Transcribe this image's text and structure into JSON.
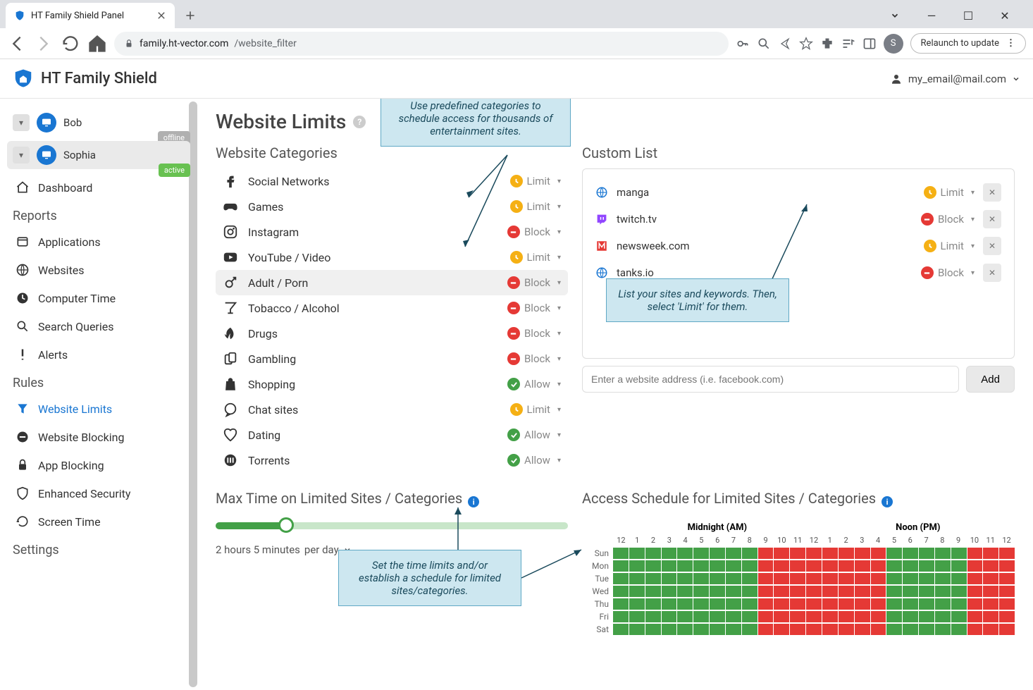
{
  "browser": {
    "tab_title": "HT Family Shield Panel",
    "url_host": "family.ht-vector.com",
    "url_path": "/website_filter",
    "avatar_letter": "S",
    "relaunch_label": "Relaunch to update"
  },
  "app": {
    "title": "HT Family Shield",
    "user_email": "my_email@mail.com"
  },
  "sidebar": {
    "users": [
      {
        "name": "Bob",
        "status": "offline"
      },
      {
        "name": "Sophia",
        "status": "active"
      }
    ],
    "dashboard": "Dashboard",
    "section_reports": "Reports",
    "reports": [
      "Applications",
      "Websites",
      "Computer Time",
      "Search Queries",
      "Alerts"
    ],
    "section_rules": "Rules",
    "rules": [
      "Website Limits",
      "Website Blocking",
      "App Blocking",
      "Enhanced Security",
      "Screen Time"
    ],
    "section_settings": "Settings"
  },
  "page": {
    "title": "Website Limits",
    "categories_heading": "Website Categories",
    "categories": [
      {
        "name": "Social Networks",
        "status": "Limit",
        "icon": "facebook"
      },
      {
        "name": "Games",
        "status": "Limit",
        "icon": "gamepad"
      },
      {
        "name": "Instagram",
        "status": "Block",
        "icon": "instagram"
      },
      {
        "name": "YouTube / Video",
        "status": "Limit",
        "icon": "youtube"
      },
      {
        "name": "Adult / Porn",
        "status": "Block",
        "icon": "adult",
        "highlight": true
      },
      {
        "name": "Tobacco / Alcohol",
        "status": "Block",
        "icon": "cocktail"
      },
      {
        "name": "Drugs",
        "status": "Block",
        "icon": "leaf"
      },
      {
        "name": "Gambling",
        "status": "Block",
        "icon": "cards"
      },
      {
        "name": "Shopping",
        "status": "Allow",
        "icon": "bag"
      },
      {
        "name": "Chat sites",
        "status": "Limit",
        "icon": "chat"
      },
      {
        "name": "Dating",
        "status": "Allow",
        "icon": "heart"
      },
      {
        "name": "Torrents",
        "status": "Allow",
        "icon": "torrent"
      }
    ],
    "custom_heading": "Custom List",
    "custom": [
      {
        "name": "manga",
        "status": "Limit",
        "icon": "globe"
      },
      {
        "name": "twitch.tv",
        "status": "Block",
        "icon": "twitch"
      },
      {
        "name": "newsweek.com",
        "status": "Limit",
        "icon": "newsweek"
      },
      {
        "name": "tanks.io",
        "status": "Block",
        "icon": "globe"
      }
    ],
    "add_placeholder": "Enter a website address (i.e. facebook.com)",
    "add_label": "Add",
    "maxtime_heading": "Max Time on Limited Sites / Categories",
    "maxtime_value": "2 hours 5 minutes",
    "maxtime_unit": "per day",
    "schedule_heading": "Access Schedule for Limited Sites / Categories",
    "schedule_am": "Midnight (AM)",
    "schedule_pm": "Noon (PM)",
    "schedule_ticks": [
      "12",
      "1",
      "2",
      "3",
      "4",
      "5",
      "6",
      "7",
      "8",
      "9",
      "10",
      "11",
      "12",
      "1",
      "2",
      "3",
      "4",
      "5",
      "6",
      "7",
      "8",
      "9",
      "10",
      "11",
      "12"
    ],
    "schedule_days": [
      "Sun",
      "Mon",
      "Tue",
      "Wed",
      "Thu",
      "Fri",
      "Sat"
    ],
    "schedule_block_ranges": [
      9,
      10,
      11,
      12,
      13,
      14,
      15,
      16
    ]
  },
  "callouts": {
    "top": "Use predefined categories to schedule access for thousands of entertainment sites.",
    "right": "List your sites and keywords. Then, select 'Limit' for them.",
    "bottom": "Set the time limits and/or establish a schedule for limited sites/categories."
  }
}
